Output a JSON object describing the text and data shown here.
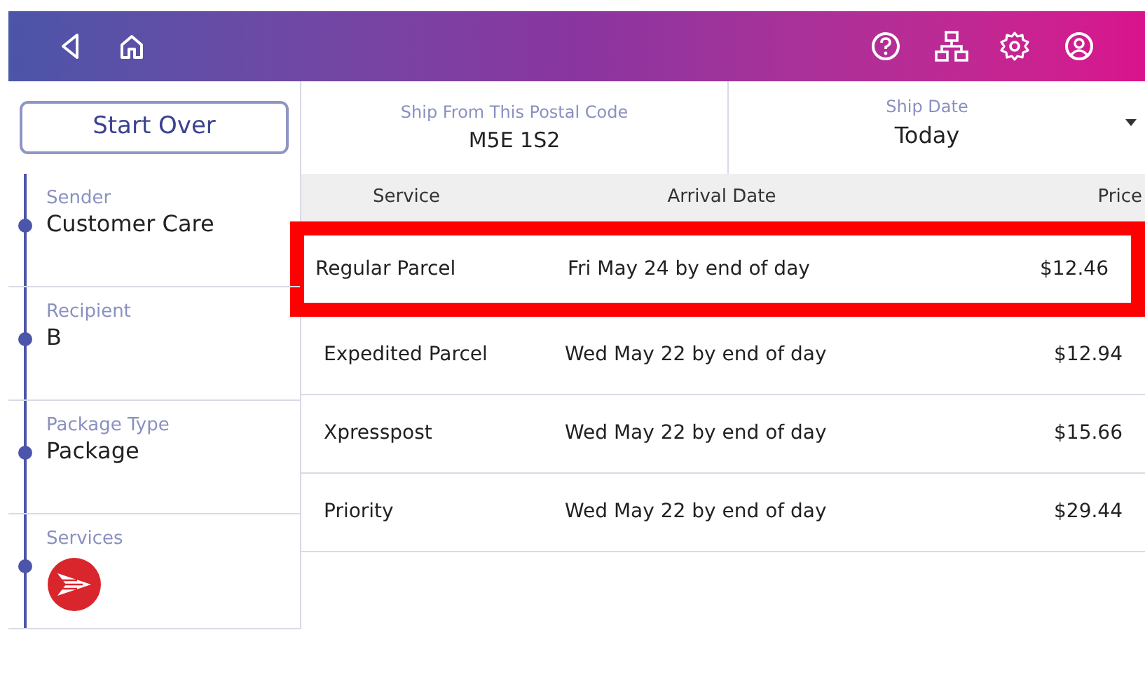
{
  "start_over": "Start Over",
  "ship_from": {
    "label": "Ship From This Postal Code",
    "value": "M5E 1S2"
  },
  "ship_date": {
    "label": "Ship Date",
    "value": "Today"
  },
  "steps": [
    {
      "label": "Sender",
      "value": "Customer Care",
      "kind": "text"
    },
    {
      "label": "Recipient",
      "value": "B",
      "kind": "text"
    },
    {
      "label": "Package Type",
      "value": "Package",
      "kind": "text"
    },
    {
      "label": "Services",
      "kind": "logo"
    }
  ],
  "table": {
    "columns": [
      "Service",
      "Arrival Date",
      "Price"
    ],
    "rows": [
      {
        "service": "Regular Parcel",
        "arrival": "Fri May 24 by end of day",
        "price": "$12.46",
        "highlighted": true
      },
      {
        "service": "Expedited Parcel",
        "arrival": "Wed May 22 by end of day",
        "price": "$12.94",
        "highlighted": false
      },
      {
        "service": "Xpresspost",
        "arrival": "Wed May 22 by end of day",
        "price": "$15.66",
        "highlighted": false
      },
      {
        "service": "Priority",
        "arrival": "Wed May 22 by end of day",
        "price": "$29.44",
        "highlighted": false
      }
    ]
  }
}
